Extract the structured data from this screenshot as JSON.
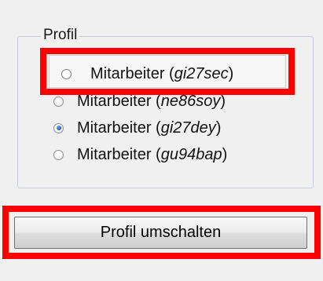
{
  "group": {
    "legend": "Profil",
    "options": [
      {
        "prefix": "Mitarbeiter (",
        "id": "gi27sec",
        "suffix": ")",
        "selected": false,
        "focused": true
      },
      {
        "prefix": "Mitarbeiter (",
        "id": "ne86soy",
        "suffix": ")",
        "selected": false,
        "focused": false
      },
      {
        "prefix": "Mitarbeiter (",
        "id": "gi27dey",
        "suffix": ")",
        "selected": true,
        "focused": false
      },
      {
        "prefix": "Mitarbeiter (",
        "id": "gu94bap",
        "suffix": ")",
        "selected": false,
        "focused": false
      }
    ]
  },
  "actions": {
    "switch_label": "Profil umschalten"
  },
  "colors": {
    "highlight": "#ff0000",
    "radio_selected": "#1f5fb5"
  }
}
